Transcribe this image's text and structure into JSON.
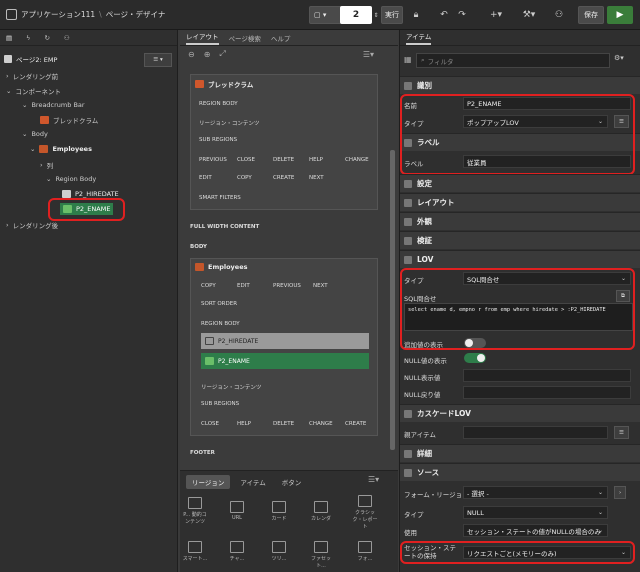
{
  "header": {
    "app": "アプリケーション111",
    "page": "ページ・デザイナ",
    "page_number": "2",
    "run": "実行",
    "save": "保存"
  },
  "left": {
    "tabs": [
      "ページ2: EMP"
    ],
    "root": "ページ2: EMP",
    "pre": "レンダリング前",
    "components": "コンポーネント",
    "breadcrumb_bar": "Breadcrumb Bar",
    "breadcrumb": "ブレッドクラム",
    "body": "Body",
    "employees": "Employees",
    "columns": "列",
    "region_body": "Region Body",
    "hiredate": "P2_HIREDATE",
    "ename": "P2_ENAME",
    "post": "レンダリング後"
  },
  "mid": {
    "tabs": [
      "レイアウト",
      "ページ検索",
      "ヘルプ"
    ],
    "breadcrumb_title": "ブレッドクラム",
    "region_body": "REGION BODY",
    "region_content": "リージョン・コンテンツ",
    "sub_regions": "SUB REGIONS",
    "btn_row1": [
      "PREVIOUS",
      "CLOSE",
      "DELETE",
      "HELP",
      "CHANGE"
    ],
    "btn_row2": [
      "EDIT",
      "COPY",
      "CREATE",
      "NEXT"
    ],
    "smart_filters": "SMART FILTERS",
    "full_width": "FULL WIDTH CONTENT",
    "body_label": "BODY",
    "employees": "Employees",
    "emp_btns": [
      "COPY",
      "EDIT",
      "PREVIOUS",
      "NEXT"
    ],
    "sort_order": "SORT ORDER",
    "hiredate": "P2_HIREDATE",
    "ename": "P2_ENAME",
    "close_btns": [
      "CLOSE",
      "HELP",
      "DELETE",
      "CHANGE",
      "CREATE"
    ],
    "footer": "FOOTER",
    "gallery_tabs": [
      "リージョン",
      "アイテム",
      "ボタン"
    ],
    "gallery": [
      "P... 動的コンテンツ",
      "URL",
      "カード",
      "カレンダ",
      "クラシック・レポート",
      "スマート...",
      "チャ...",
      "ツリ...",
      "ファセット...",
      "フォ..."
    ]
  },
  "right": {
    "tab": "アイテム",
    "filter_placeholder": "フィルタ",
    "sec_identity": "識別",
    "name_label": "名前",
    "name_value": "P2_ENAME",
    "type_label": "タイプ",
    "type_value": "ポップアップLOV",
    "sec_label": "ラベル",
    "label_label": "ラベル",
    "label_value": "従業員",
    "sec_settings": "設定",
    "sec_layout": "レイアウト",
    "sec_appearance": "外観",
    "sec_validation": "検証",
    "sec_lov": "LOV",
    "lov_type_label": "タイプ",
    "lov_type_value": "SQL問合せ",
    "sql_label": "SQL問合せ",
    "sql_value": "select ename d, empno r from emp where hiredate > :P2_HIREDATE",
    "add_display": "追加値の表示",
    "null_display": "NULL値の表示",
    "null_display_value": "NULL表示値",
    "null_return": "NULL戻り値",
    "sec_cascade": "カスケードLOV",
    "parent_item": "親アイテム",
    "sec_detail": "詳細",
    "sec_source": "ソース",
    "form_region": "フォーム・リージョン",
    "form_region_value": "- 選択 -",
    "src_type": "タイプ",
    "src_type_value": "NULL",
    "used": "使用",
    "used_value": "セッション・ステートの値がNULLの場合のみ",
    "session_keep": "セッション・ステートの保持",
    "session_keep_value": "リクエストごと(メモリーのみ)"
  }
}
